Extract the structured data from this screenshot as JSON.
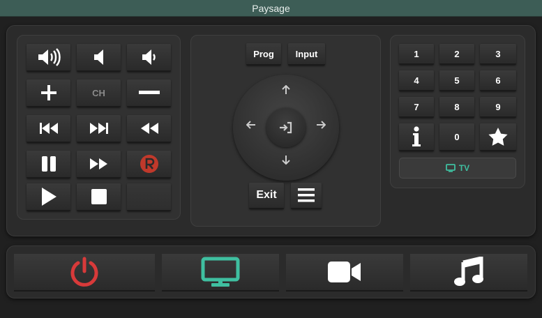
{
  "window": {
    "title": "Paysage"
  },
  "audio_panel": {
    "ch_label": "CH"
  },
  "nav_panel": {
    "prog_label": "Prog",
    "input_label": "Input",
    "exit_label": "Exit"
  },
  "numpad": {
    "keys": [
      "1",
      "2",
      "3",
      "4",
      "5",
      "6",
      "7",
      "8",
      "9",
      "0"
    ],
    "tv_label": "TV"
  },
  "colors": {
    "accent_teal": "#3fbfa0",
    "power_red": "#d83a3a",
    "record_red": "#c0392b",
    "titlebar": "#3d5d56"
  }
}
